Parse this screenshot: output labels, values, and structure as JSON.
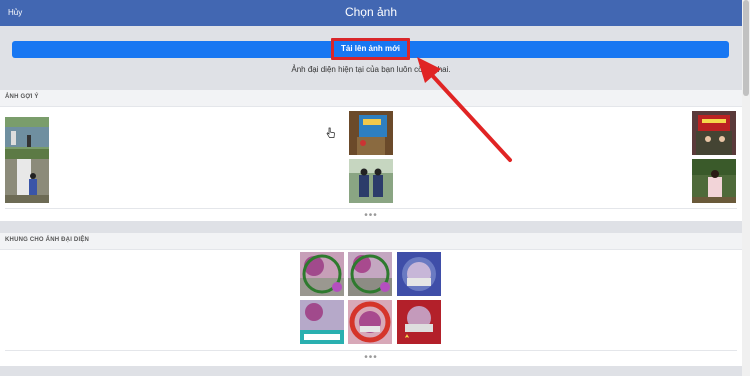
{
  "header": {
    "cancel": "Hủy",
    "title": "Chọn ảnh"
  },
  "upload": {
    "button": "Tải lên ảnh mới",
    "note": "Ảnh đại diện hiện tại của bạn luôn công khai."
  },
  "suggested": {
    "title": "ẢNH GỢI Ý",
    "more": "•••"
  },
  "frames": {
    "title": "KHUNG CHO ẢNH ĐẠI DIỆN",
    "more": "•••"
  },
  "colors": {
    "accent": "#1877f2",
    "header": "#4267b2",
    "highlight": "#d9262a"
  }
}
